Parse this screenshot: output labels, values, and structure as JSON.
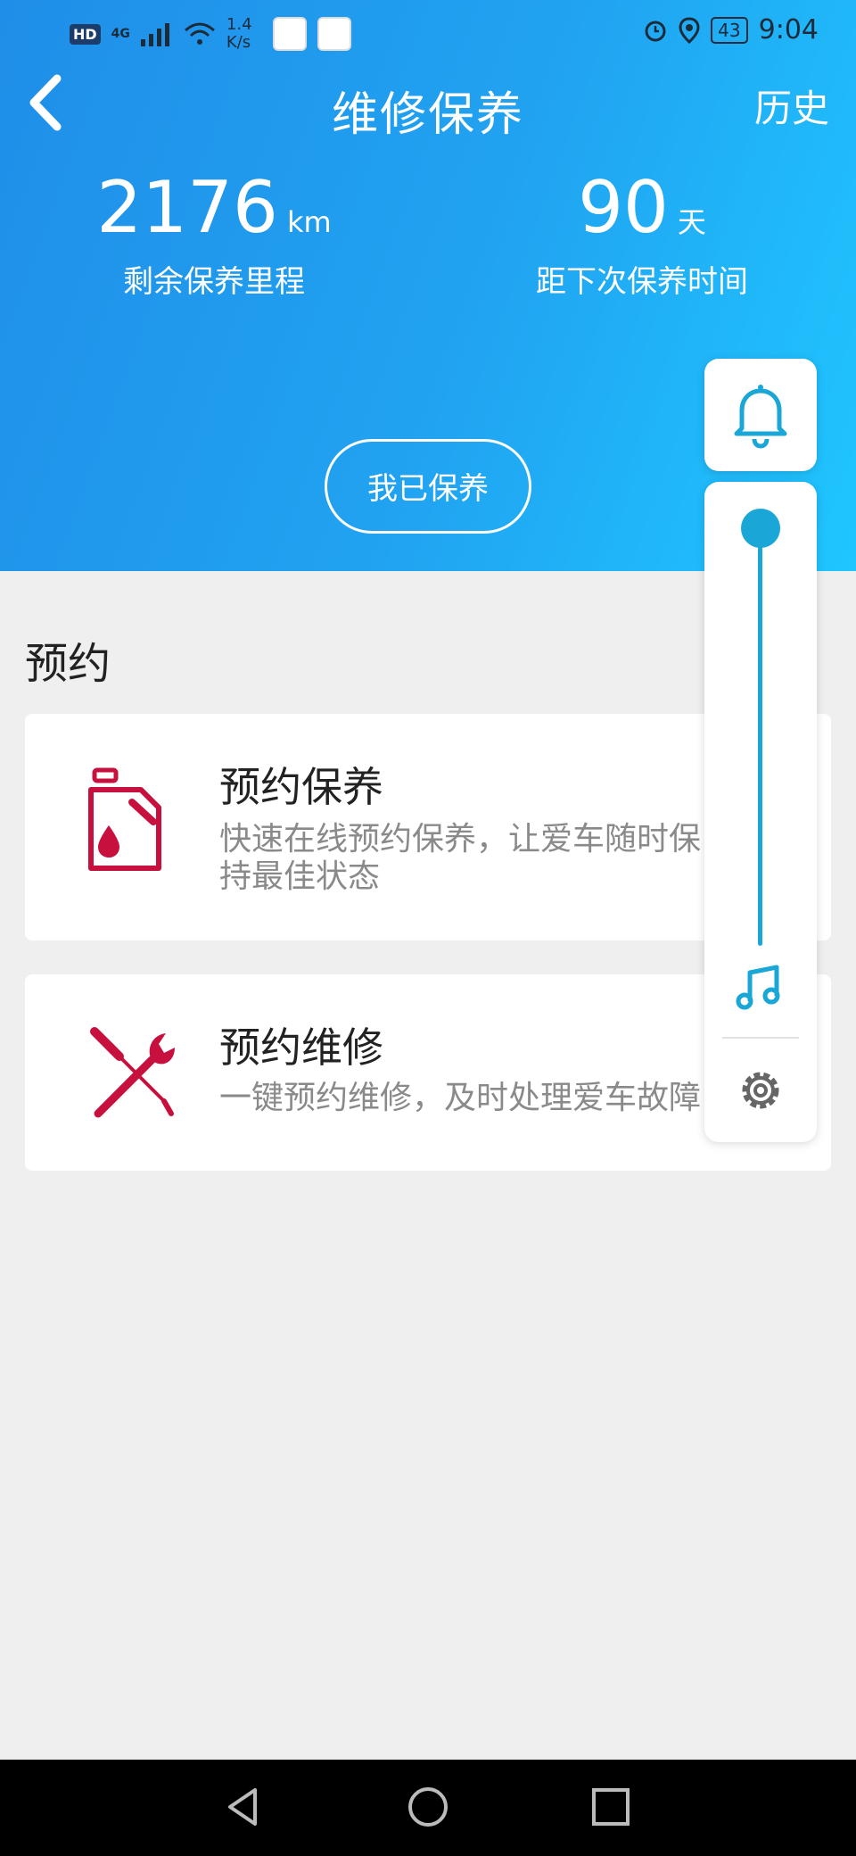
{
  "status_bar": {
    "hd": "HD",
    "network": "4G",
    "speed": "1.4 K/s",
    "battery": "43",
    "time": "9:04"
  },
  "header": {
    "title": "维修保养",
    "history_label": "历史",
    "remaining_mileage": {
      "value": "2176",
      "unit": "km",
      "label": "剩余保养里程"
    },
    "days_to_next": {
      "value": "90",
      "unit": "天",
      "label": "距下次保养时间"
    },
    "done_button": "我已保养"
  },
  "section": {
    "title": "预约"
  },
  "cards": [
    {
      "title": "预约保养",
      "description": "快速在线预约保养，让爱车随时保持最佳状态",
      "icon": "oil-can-icon"
    },
    {
      "title": "预约维修",
      "description": "一键预约维修，及时处理爱车故障",
      "icon": "tools-icon"
    }
  ],
  "floating": {
    "bell_icon": "bell-icon",
    "music_icon": "music-icon",
    "settings_icon": "gear-icon",
    "volume_level": 1.0
  },
  "colors": {
    "header_start": "#1f8ee8",
    "header_end": "#1fc6ff",
    "accent": "#1aa6d6",
    "icon_red": "#c8103e"
  }
}
